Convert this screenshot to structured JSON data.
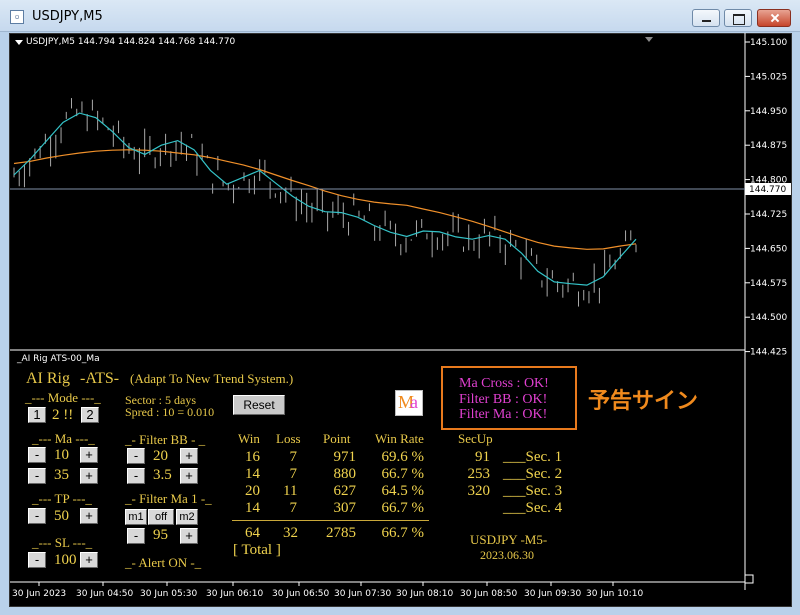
{
  "window": {
    "title": "USDJPY,M5"
  },
  "chart": {
    "info": "USDJPY,M5  144.794 144.824 144.768 144.770",
    "current_price": "144.770",
    "price_ticks": [
      "145.100",
      "145.025",
      "144.950",
      "144.875",
      "144.800",
      "144.725",
      "144.650",
      "144.575",
      "144.500",
      "144.425"
    ],
    "time_ticks": [
      "30 Jun 2023",
      "30 Jun 04:50",
      "30 Jun 05:30",
      "30 Jun 06:10",
      "30 Jun 06:50",
      "30 Jun 07:30",
      "30 Jun 08:10",
      "30 Jun 08:50",
      "30 Jun 09:30",
      "30 Jun 10:10"
    ],
    "colors": {
      "candles": "#a9a9a9",
      "fast_ma": "#34c3c8",
      "slow_ma": "#f0902a",
      "price_line": "#7f8fa8"
    },
    "chart_data": {
      "type": "line",
      "series": [
        {
          "values": [
            144.835,
            144.84,
            144.847,
            144.853,
            144.858,
            144.862,
            144.864,
            144.865,
            144.864,
            144.862,
            144.858,
            144.854,
            144.848,
            144.84,
            144.832,
            144.822,
            144.81,
            144.798,
            144.787,
            144.775,
            144.765,
            144.757,
            144.751,
            144.747,
            144.744,
            144.736,
            144.728,
            144.719,
            144.709,
            144.698,
            144.686,
            144.674,
            144.663,
            144.655,
            144.651,
            144.648,
            144.649,
            144.655,
            144.66
          ]
        },
        {
          "values": [
            144.81,
            144.845,
            144.885,
            144.925,
            144.945,
            144.935,
            144.905,
            144.87,
            144.855,
            144.875,
            144.885,
            144.865,
            144.82,
            144.79,
            144.805,
            144.82,
            144.792,
            144.764,
            144.742,
            144.73,
            144.728,
            144.718,
            144.7,
            144.685,
            144.676,
            144.688,
            144.686,
            144.675,
            144.67,
            144.678,
            144.67,
            144.64,
            144.6,
            144.577,
            144.573,
            144.57,
            144.588,
            144.63,
            144.67
          ]
        }
      ]
    },
    "subwindow_title": "_AI Rig ATS-00_Ma"
  },
  "panel": {
    "title_left": "AI Rig",
    "title_mid": "-ATS-",
    "title_desc": "(Adapt To New Trend System.)",
    "mode_label": "_--- Mode ---_",
    "mode_btn1": "1",
    "mode_value": "2 !!",
    "mode_btn2": "2",
    "sector": "Sector : 5 days",
    "spread": "Spred : 10 = 0.010",
    "reset": "Reset",
    "ma_label": "_--- Ma ---_",
    "ma_values": [
      "10",
      "35"
    ],
    "tp_label": "_--- TP ---_",
    "tp_value": "50",
    "sl_label": "_--- SL ---_",
    "sl_value": "100",
    "filter_bb_label": "_- Filter BB - _",
    "bb_values": [
      "20",
      "3.5"
    ],
    "filter_ma1_label": "_- Filter Ma 1 -_",
    "ma1_btns": [
      "m1",
      "off",
      "m2"
    ],
    "ma1_value": "95",
    "alert": "_- Alert ON -_",
    "minus": "-",
    "plus": "+",
    "logo_m": "M",
    "logo_a": "a",
    "signals": [
      "Ma Cross : OK!",
      "Filter BB  : OK!",
      "Filter Ma  : OK!"
    ],
    "yokoku": "予告サイン",
    "stats": {
      "headers": [
        "Win",
        "Loss",
        "Point",
        "Win Rate"
      ],
      "rows": [
        [
          "16",
          "7",
          "971",
          "69.6 %"
        ],
        [
          "14",
          "7",
          "880",
          "66.7 %"
        ],
        [
          "20",
          "11",
          "627",
          "64.5 %"
        ],
        [
          "14",
          "7",
          "307",
          "66.7 %"
        ]
      ],
      "total": [
        "64",
        "32",
        "2785",
        "66.7 %"
      ],
      "total_label": "[ Total ]"
    },
    "secup": {
      "header": "SecUp",
      "values": [
        "91",
        "253",
        "320",
        ""
      ],
      "labels": [
        "___Sec. 1",
        "___Sec. 2",
        "___Sec. 3",
        "___Sec. 4"
      ]
    },
    "footer_symbol": "USDJPY  -M5-",
    "footer_date": "2023.06.30"
  }
}
